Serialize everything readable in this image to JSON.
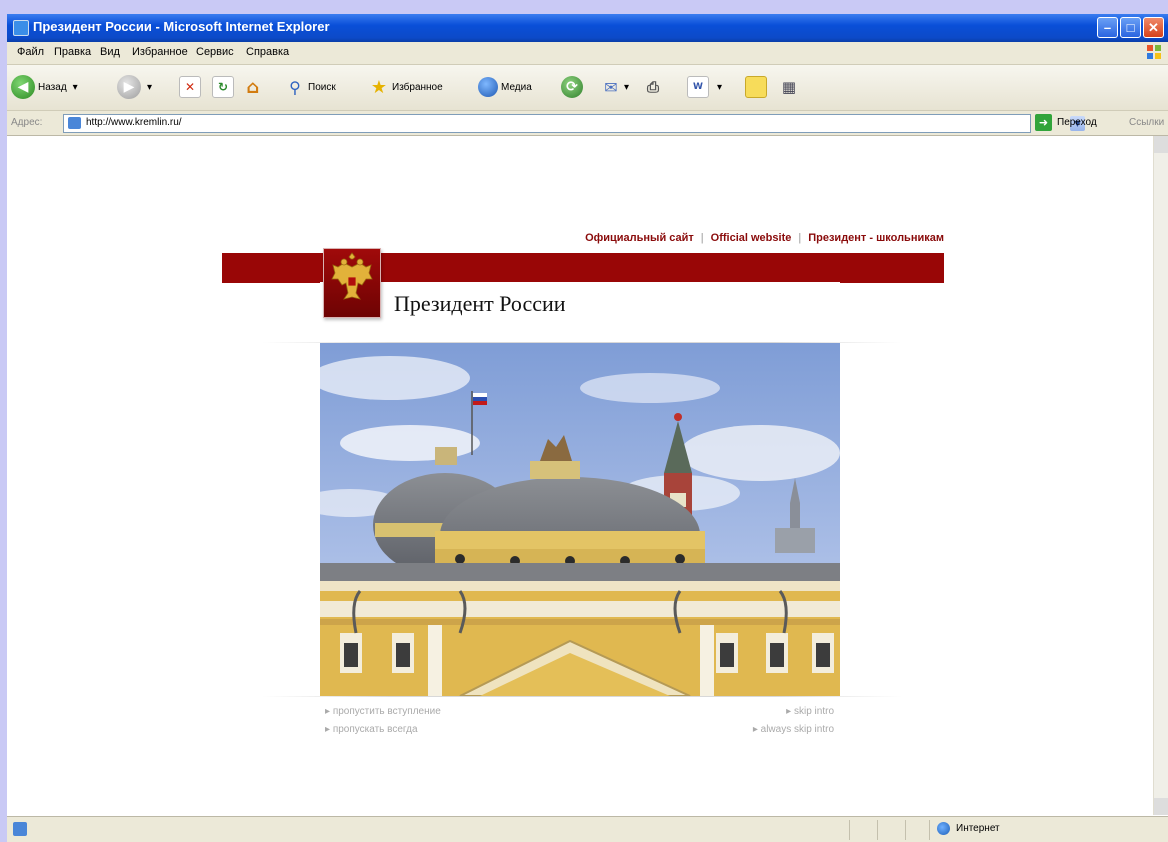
{
  "window": {
    "title": "Президент России - Microsoft Internet Explorer"
  },
  "menu": [
    "Файл",
    "Правка",
    "Вид",
    "Избранное",
    "Сервис",
    "Справка"
  ],
  "toolbar": {
    "back_label": "Назад",
    "search_label": "Поиск",
    "favorites_label": "Избранное",
    "media_label": "Медиа"
  },
  "address": {
    "label": "Адрес:",
    "url": "http://www.kremlin.ru/",
    "go_label": "Переход",
    "links_label": "Ссылки"
  },
  "page": {
    "top_links": [
      "Официальный сайт",
      "Official website",
      "Президент - школьникам"
    ],
    "site_title": "Президент России",
    "skip_intro_ru": "пропустить вступление",
    "always_skip_ru": "пропускать всегда",
    "skip_intro_en": "skip intro",
    "always_skip_en": "always skip intro"
  },
  "status": {
    "zone": "Интернет"
  },
  "colors": {
    "brand_red": "#990606",
    "link_red": "#8a0b0b"
  }
}
